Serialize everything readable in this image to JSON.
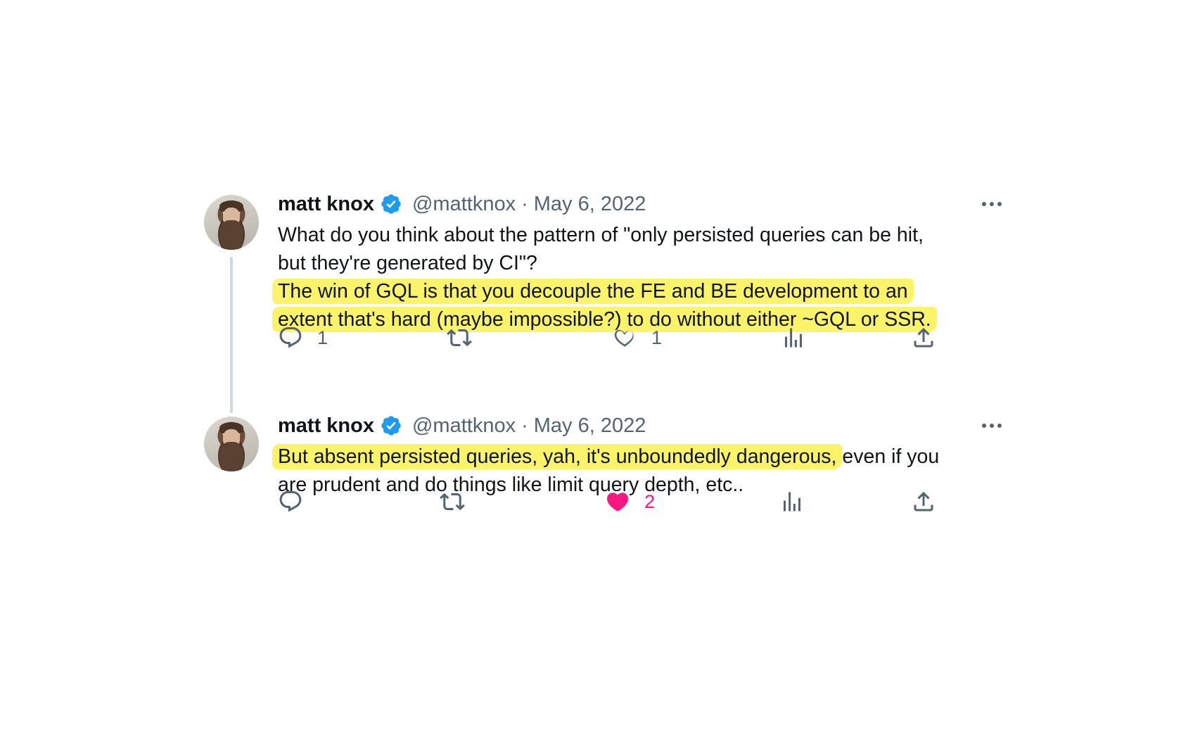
{
  "tweets": [
    {
      "author_name": "matt knox",
      "handle": "@mattknox",
      "separator": "·",
      "date": "May 6, 2022",
      "text_plain": "What do you think about the pattern of \"only persisted queries can be hit,",
      "text_plain_2": "but they're generated by CI\"?",
      "text_hl": "The win of GQL is that you decouple the FE and BE development to an",
      "text_hl_2": "extent that's hard (maybe impossible?) to do without either ~GQL or SSR.",
      "reply_count": "1",
      "retweet_count": "",
      "like_count": "1",
      "liked": false
    },
    {
      "author_name": "matt knox",
      "handle": "@mattknox",
      "separator": "·",
      "date": "May 6, 2022",
      "text_hl": "But absent persisted queries, yah, it's unboundedly dangerous,",
      "text_after": " even if you",
      "text_line2": "are prudent and do things like limit query depth, etc..",
      "reply_count": "",
      "retweet_count": "",
      "like_count": "2",
      "liked": true
    }
  ],
  "colors": {
    "verified": "#1d9bf0",
    "highlight": "#fbf36a",
    "secondary_text": "#536471",
    "like_active": "#f91880"
  },
  "icons": [
    "verified-badge-icon",
    "more-icon",
    "reply-icon",
    "retweet-icon",
    "like-icon",
    "views-icon",
    "share-icon"
  ]
}
